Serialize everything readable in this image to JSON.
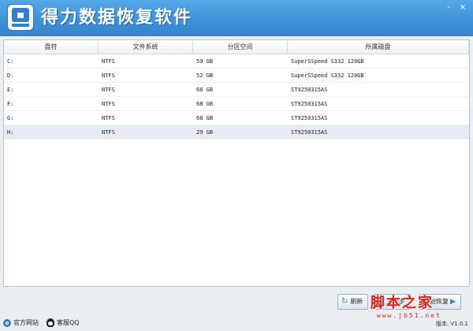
{
  "app": {
    "title": "得力数据恢复软件",
    "window_controls": [
      "-",
      "×"
    ]
  },
  "table": {
    "columns": [
      "盘符",
      "文件系统",
      "分区空间",
      "所属磁盘"
    ],
    "rows": [
      {
        "drive": "C:",
        "fs": "NTFS",
        "size": "59 GB",
        "disk": "SuperSSpeed S332 120GB"
      },
      {
        "drive": "D:",
        "fs": "NTFS",
        "size": "52 GB",
        "disk": "SuperSSpeed S332 120GB"
      },
      {
        "drive": "E:",
        "fs": "NTFS",
        "size": "66 GB",
        "disk": "ST9250315AS"
      },
      {
        "drive": "F:",
        "fs": "NTFS",
        "size": "68 GB",
        "disk": "ST9250315AS"
      },
      {
        "drive": "G:",
        "fs": "NTFS",
        "size": "68 GB",
        "disk": "ST9250315AS"
      },
      {
        "drive": "H:",
        "fs": "NTFS",
        "size": "29 GB",
        "disk": "ST9250315AS"
      }
    ],
    "selected_row": 5
  },
  "footer": {
    "refresh_label": "刷新",
    "prev_label": "上一步",
    "start_label": "开始恢复",
    "watermark": "脚本之家",
    "watermark_url": "www.jb51.net",
    "official_site": "官方网站",
    "support_qq": "客服QQ",
    "version": "版本: V1.0.1"
  },
  "colors": {
    "titlebar": "#3f93d9",
    "accent": "#2f80c8",
    "watermark": "#e0221b"
  }
}
